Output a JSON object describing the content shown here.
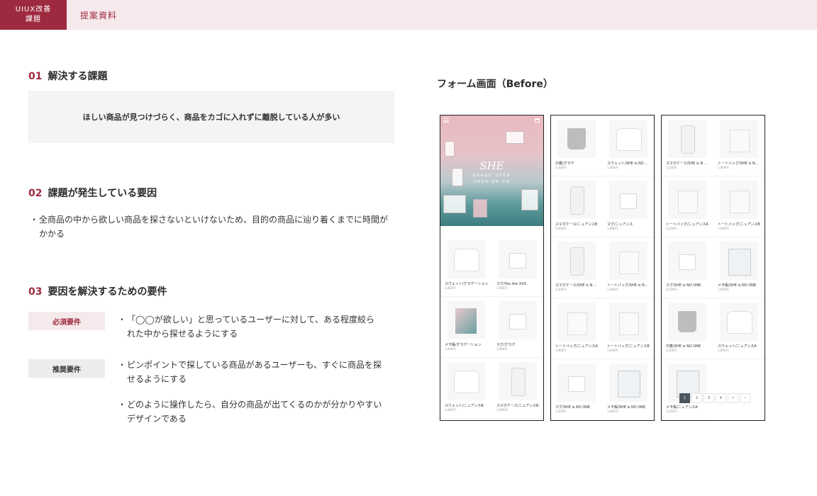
{
  "header": {
    "tag_line1": "UIUX改善",
    "tag_line2": "課題",
    "title": "提案資料"
  },
  "sections": [
    {
      "num": "01",
      "title": "解決する課題"
    },
    {
      "num": "02",
      "title": "課題が発生している要因"
    },
    {
      "num": "03",
      "title": "要因を解決するための要件"
    }
  ],
  "problem": "ほしい商品が見つけづらく、商品をカゴに入れずに離脱している人が多い",
  "causes": [
    "全商品の中から欲しい商品を探さないといけないため、目的の商品に辿り着くまでに時間がかかる"
  ],
  "requirements": {
    "must_label": "必須要件",
    "must": [
      "「◯◯が欲しい」と思っているユーザーに対して、ある程度絞られた中から探せるようにする"
    ],
    "recommended_label": "推奨要件",
    "recommended": [
      "ピンポイントで探している商品があるユーザーも、すぐに商品を探せるようにする",
      "どのように操作したら、自分の商品が出てくるのかが分かりやすいデザインである"
    ]
  },
  "bullet_mark": "・",
  "form": {
    "title": "フォーム画面（Before）",
    "hero": {
      "logo": "SHE",
      "grand_open": "GRAND OPEN",
      "date": "2020.09.30"
    },
    "screen1": [
      {
        "name": "スウェット/グラデーション",
        "price": "3,800円",
        "kind": "sweat"
      },
      {
        "name": "マグ/You Are XXX.",
        "price": "1,800円",
        "kind": "mug"
      },
      {
        "name": "メモ帳/グラデーション",
        "price": "1,000円",
        "kind": "memo"
      },
      {
        "name": "マグ/グラデ",
        "price": "1,800円",
        "kind": "mug"
      },
      {
        "name": "スウェット/ニュアンスB",
        "price": "3,800円",
        "kind": "sweat"
      },
      {
        "name": "スマホケース/ニュアンスB",
        "price": "1,800円",
        "kind": "case"
      }
    ],
    "screen2": [
      {
        "name": "巾着/グラデ",
        "price": "3,200円",
        "kind": "pouch"
      },
      {
        "name": "スウェット/SHE is NO ...",
        "price": "1,800円",
        "kind": "sweat"
      },
      {
        "name": "スマホケース/ニュアンスB",
        "price": "3,800円",
        "kind": "case"
      },
      {
        "name": "マグ/ニュアンス",
        "price": "1,800円",
        "kind": "mug"
      },
      {
        "name": "スマホケース/SHE is N ...",
        "price": "3,200円",
        "kind": "case"
      },
      {
        "name": "トートバッグ/SHE is N...",
        "price": "1,800円",
        "kind": "bag"
      },
      {
        "name": "トートバッグ/ニュアンスA",
        "price": "3,800円",
        "kind": "bag"
      },
      {
        "name": "トートバッグ/ニュアンスB",
        "price": "1,800円",
        "kind": "bag"
      },
      {
        "name": "マグ/SHE is NO ONE.",
        "price": "3,200円",
        "kind": "mug"
      },
      {
        "name": "メモ帳/SHE is NO ONE.",
        "price": "1,800円",
        "kind": "memo-w"
      }
    ],
    "screen3": [
      {
        "name": "スマホケース/SHE is N ...",
        "price": "3,200円",
        "kind": "case"
      },
      {
        "name": "トートバッグ/SHE is N...",
        "price": "1,800円",
        "kind": "bag"
      },
      {
        "name": "トートバッグ/ニュアンスA",
        "price": "3,200円",
        "kind": "bag"
      },
      {
        "name": "トートバッグ/ニュアンスB",
        "price": "1,800円",
        "kind": "bag"
      },
      {
        "name": "マグ/SHE is NO ONE.",
        "price": "3,200円",
        "kind": "mug"
      },
      {
        "name": "メモ帳/SHE is NO ONE.",
        "price": "1,800円",
        "kind": "memo-w"
      },
      {
        "name": "巾着/SHE is NO ONE.",
        "price": "3,200円",
        "kind": "pouch"
      },
      {
        "name": "スウェット/ニュアンスA",
        "price": "1,800円",
        "kind": "sweat"
      },
      {
        "name": "メモ帳/ニュアンスA",
        "price": "3,200円",
        "kind": "memo-w"
      }
    ],
    "pagination": [
      "1",
      "2",
      "3",
      "4",
      "»",
      "›"
    ]
  },
  "colors": {
    "accent": "#9e2a3f",
    "header_bg": "#f6e9ec",
    "box_bg": "#f3f4f4"
  }
}
